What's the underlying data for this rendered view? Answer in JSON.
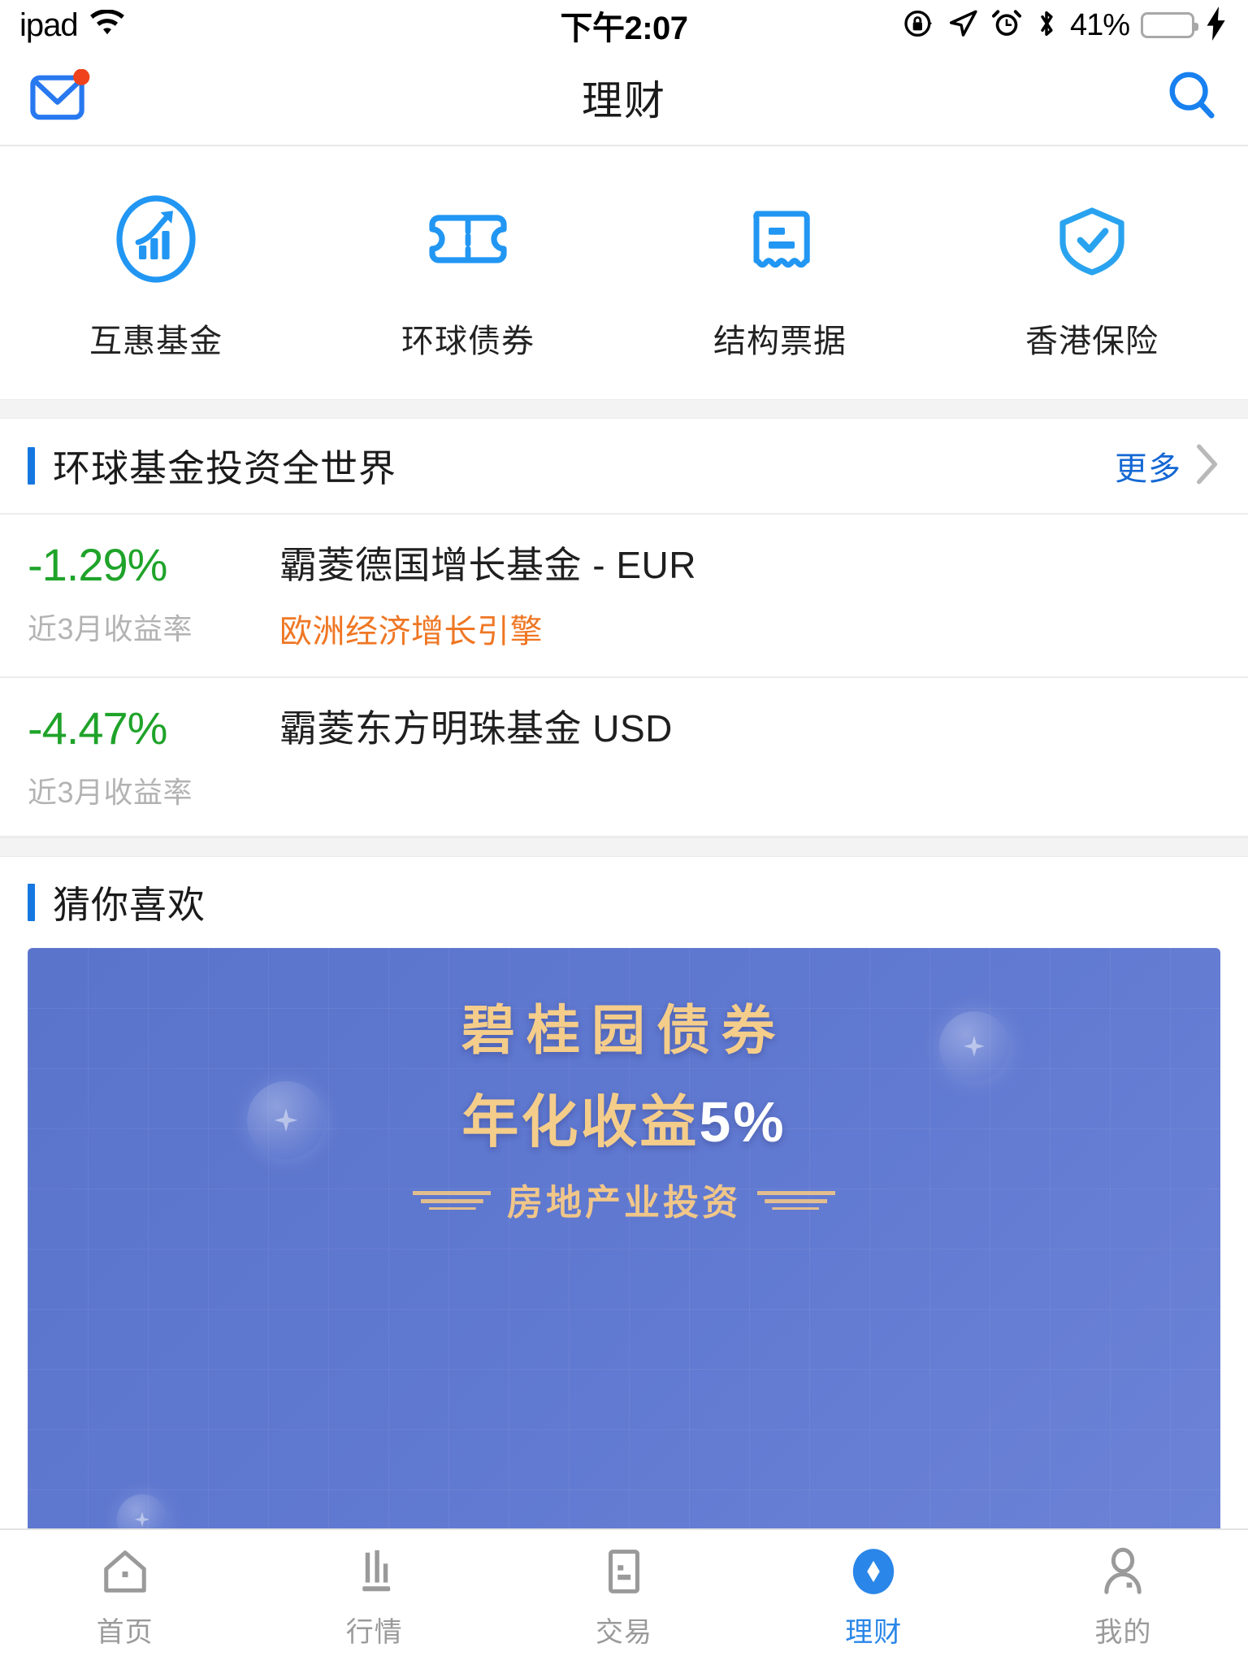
{
  "status_bar": {
    "carrier": "ipad",
    "wifi_icon": "wifi-icon",
    "time": "下午2:07",
    "rotation_lock_icon": "rotation-lock-icon",
    "location_icon": "location-arrow-icon",
    "alarm_icon": "alarm-clock-icon",
    "bluetooth_icon": "bluetooth-icon",
    "battery_percent": "41%",
    "battery_level": 41,
    "battery_color": "#4cd662",
    "charging_icon": "lightning-bolt-icon"
  },
  "navbar": {
    "mail_icon": "mail-envelope-icon",
    "mail_badge": true,
    "title": "理财",
    "search_icon": "search-icon"
  },
  "categories": [
    {
      "label": "互惠基金",
      "icon": "growth-chart-circle-icon"
    },
    {
      "label": "环球债券",
      "icon": "ticket-icon"
    },
    {
      "label": "结构票据",
      "icon": "receipt-icon"
    },
    {
      "label": "香港保险",
      "icon": "shield-check-icon"
    }
  ],
  "global_funds": {
    "title": "环球基金投资全世界",
    "more_label": "更多",
    "chevron_icon": "chevron-right-icon",
    "rows": [
      {
        "percent": "-1.29%",
        "percent_color": "#1fa32a",
        "percent_label": "近3月收益率",
        "name": "霸菱德国增长基金 - EUR",
        "tag": "欧洲经济增长引擎",
        "tag_color": "#ef7724"
      },
      {
        "percent": "-4.47%",
        "percent_color": "#1fa32a",
        "percent_label": "近3月收益率",
        "name": "霸菱东方明珠基金 USD",
        "tag": "",
        "tag_color": "#ef7724"
      }
    ]
  },
  "recommend": {
    "title": "猜你喜欢",
    "banner": {
      "line1": "碧桂园债券",
      "line2_prefix": "年化收益",
      "line2_highlight": "5%",
      "line3": "房地产业投资",
      "bg_color": "#5f78d0",
      "gold_color": "#f5cd8a"
    }
  },
  "tabbar": {
    "active_color": "#2a86e8",
    "inactive_color": "#9a9a9a",
    "items": [
      {
        "label": "首页",
        "icon": "home-icon",
        "active": false
      },
      {
        "label": "行情",
        "icon": "bar-chart-icon",
        "active": false
      },
      {
        "label": "交易",
        "icon": "trade-document-icon",
        "active": false
      },
      {
        "label": "理财",
        "icon": "finance-diamond-icon",
        "active": true
      },
      {
        "label": "我的",
        "icon": "person-icon",
        "active": false
      }
    ]
  }
}
